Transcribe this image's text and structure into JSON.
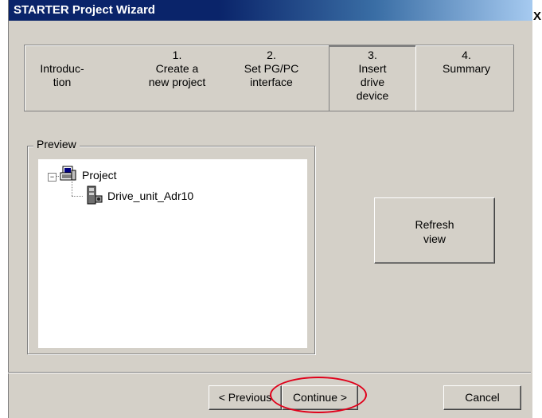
{
  "window": {
    "title": "STARTER Project Wizard",
    "close_glyph": "X"
  },
  "steps": [
    {
      "num": "",
      "label_lines": [
        "Introduc-",
        "tion"
      ]
    },
    {
      "num": "1.",
      "label_lines": [
        "Create a",
        "new project"
      ]
    },
    {
      "num": "2.",
      "label_lines": [
        "Set PG/PC",
        "interface"
      ]
    },
    {
      "num": "3.",
      "label_lines": [
        "Insert",
        "drive",
        "device"
      ]
    },
    {
      "num": "4.",
      "label_lines": [
        "Summary"
      ]
    }
  ],
  "active_step": 3,
  "preview": {
    "legend": "Preview",
    "tree": {
      "root_label": "Project",
      "root_expander": "−",
      "child_label": "Drive_unit_Adr10"
    }
  },
  "buttons": {
    "refresh_line1": "Refresh",
    "refresh_line2": "view",
    "previous": "< Previous",
    "continue": "Continue >",
    "cancel": "Cancel"
  },
  "colors": {
    "highlight": "#e0001a",
    "title_bar": "#0a246a",
    "dialog_bg": "#d4d0c8"
  }
}
